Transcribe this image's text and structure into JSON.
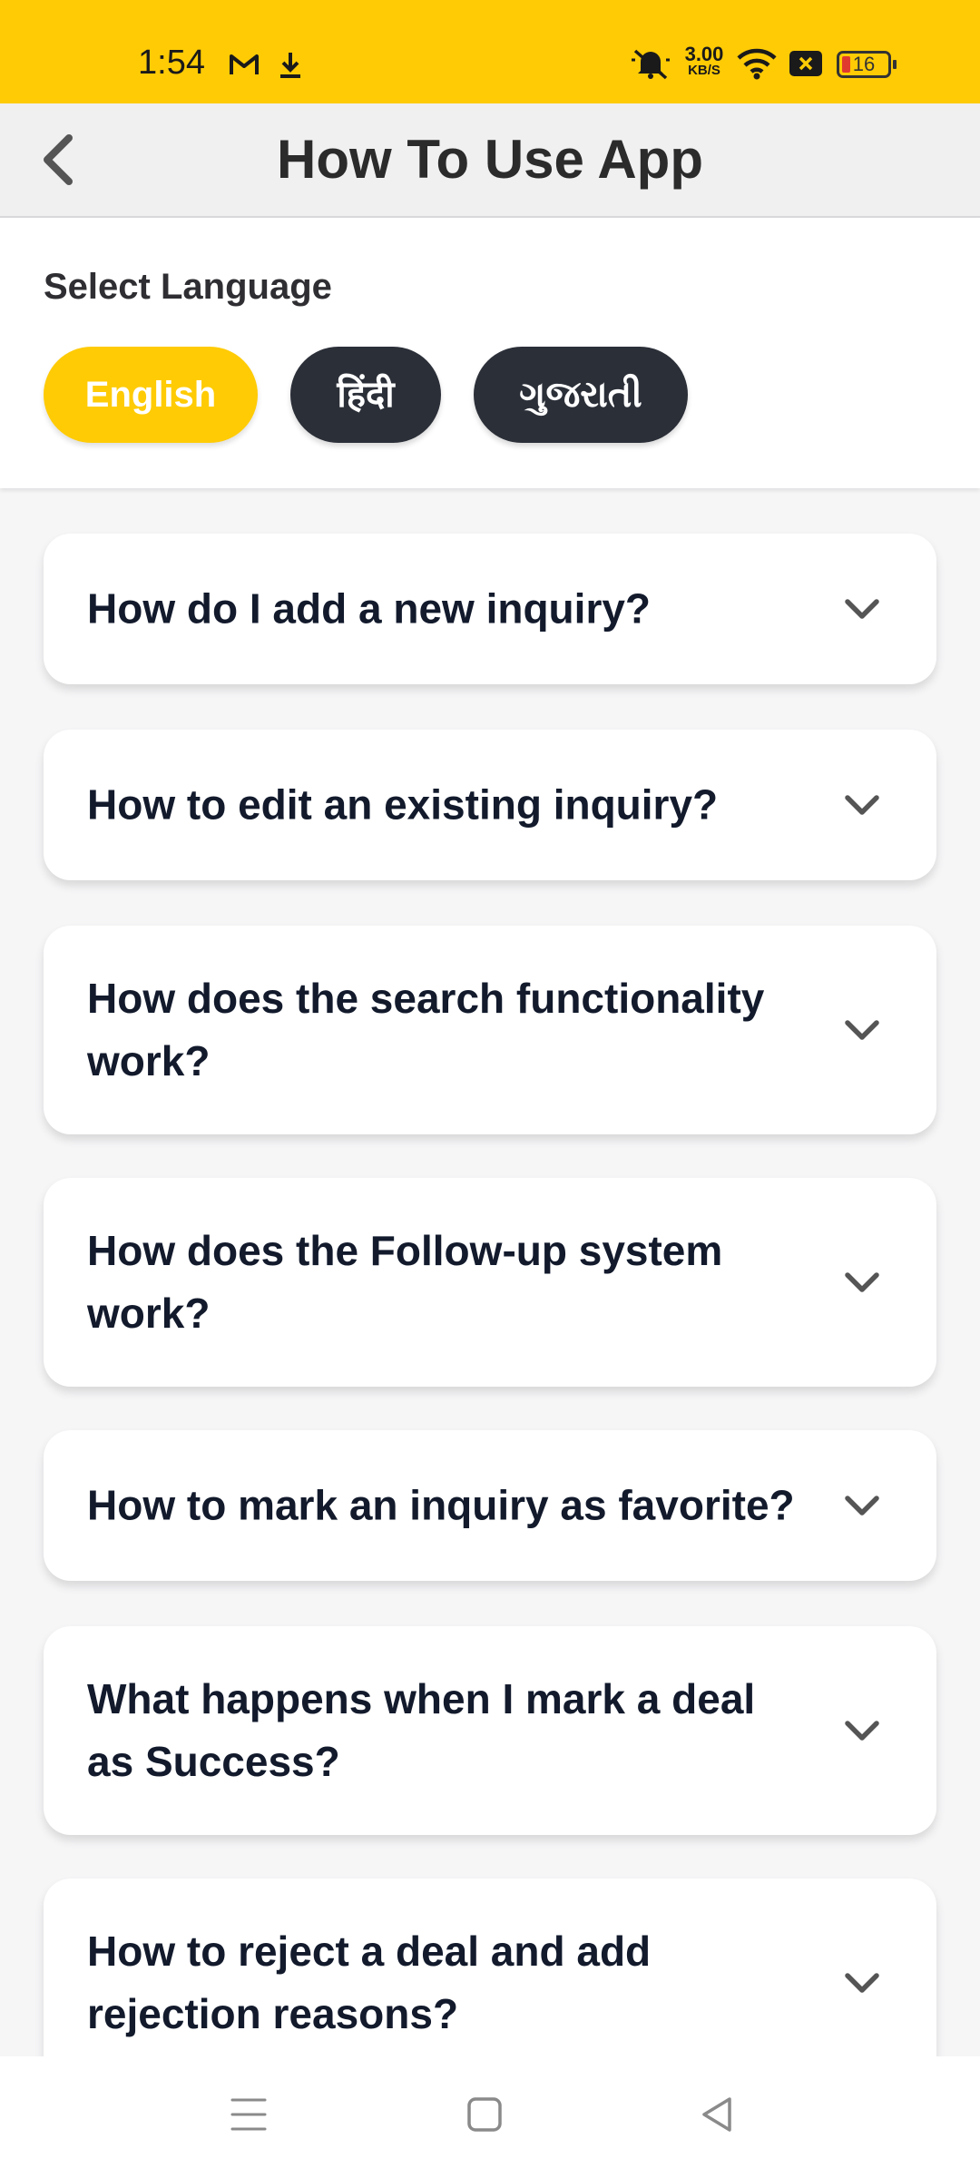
{
  "status_bar": {
    "time": "1:54",
    "speed_value": "3.00",
    "speed_unit": "KB/S",
    "battery": "16",
    "icons": [
      "gmail-icon",
      "download-icon",
      "mute-icon",
      "wifi-icon",
      "close-box-icon",
      "battery-icon"
    ]
  },
  "header": {
    "title": "How To Use App",
    "back_icon": "chevron-left-icon"
  },
  "language": {
    "label": "Select Language",
    "options": [
      "English",
      "हिंदी",
      "ગુજરાતી"
    ],
    "selected": "English",
    "colors": {
      "active": "#ffcb05",
      "inactive": "#2b2f38"
    }
  },
  "faqs": [
    {
      "question": "How do I add a new inquiry?"
    },
    {
      "question": "How to edit an existing inquiry?"
    },
    {
      "question": "How does the search functionality work?"
    },
    {
      "question": "How does the Follow-up system work?"
    },
    {
      "question": "How to mark an inquiry as favorite?"
    },
    {
      "question": "What happens when I mark a deal as Success?"
    },
    {
      "question": "How to reject a deal and add rejection reasons?"
    }
  ],
  "nav_bar": {
    "icons": [
      "menu-icon",
      "home-square-icon",
      "back-triangle-icon"
    ]
  },
  "colors": {
    "accent": "#ffcb05",
    "dark": "#2b2f38",
    "text": "#121a2c"
  }
}
